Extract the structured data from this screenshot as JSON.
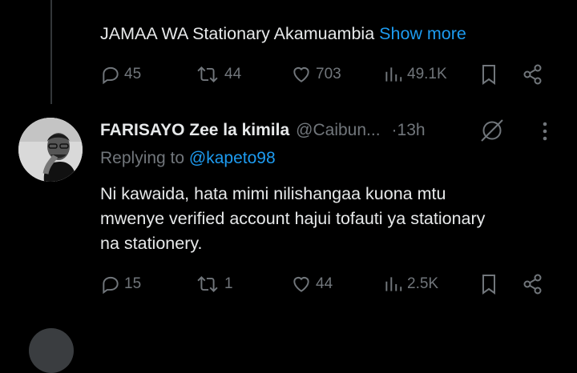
{
  "prev_tweet": {
    "text": "JAMAA WA Stationary Akamuambia",
    "show_more": "Show more",
    "replies": "45",
    "reposts": "44",
    "likes": "703",
    "views": "49.1K"
  },
  "tweet": {
    "name": "FARISAYO Zee la kimila",
    "handle": "@Caibun...",
    "time": "·13h",
    "replying_prefix": "Replying to",
    "replying_to": "@kapeto98",
    "text_line1": "Ni kawaida, hata mimi nilishangaa kuona mtu",
    "text_line2": "mwenye verified account hajui tofauti ya stationary",
    "text_line3": "na stationery.",
    "replies": "15",
    "reposts": "1",
    "likes": "44",
    "views": "2.5K"
  },
  "colors": {
    "accent": "#1d9bf0",
    "muted": "#71767b",
    "text": "#e7e9ea",
    "background": "#000000"
  }
}
